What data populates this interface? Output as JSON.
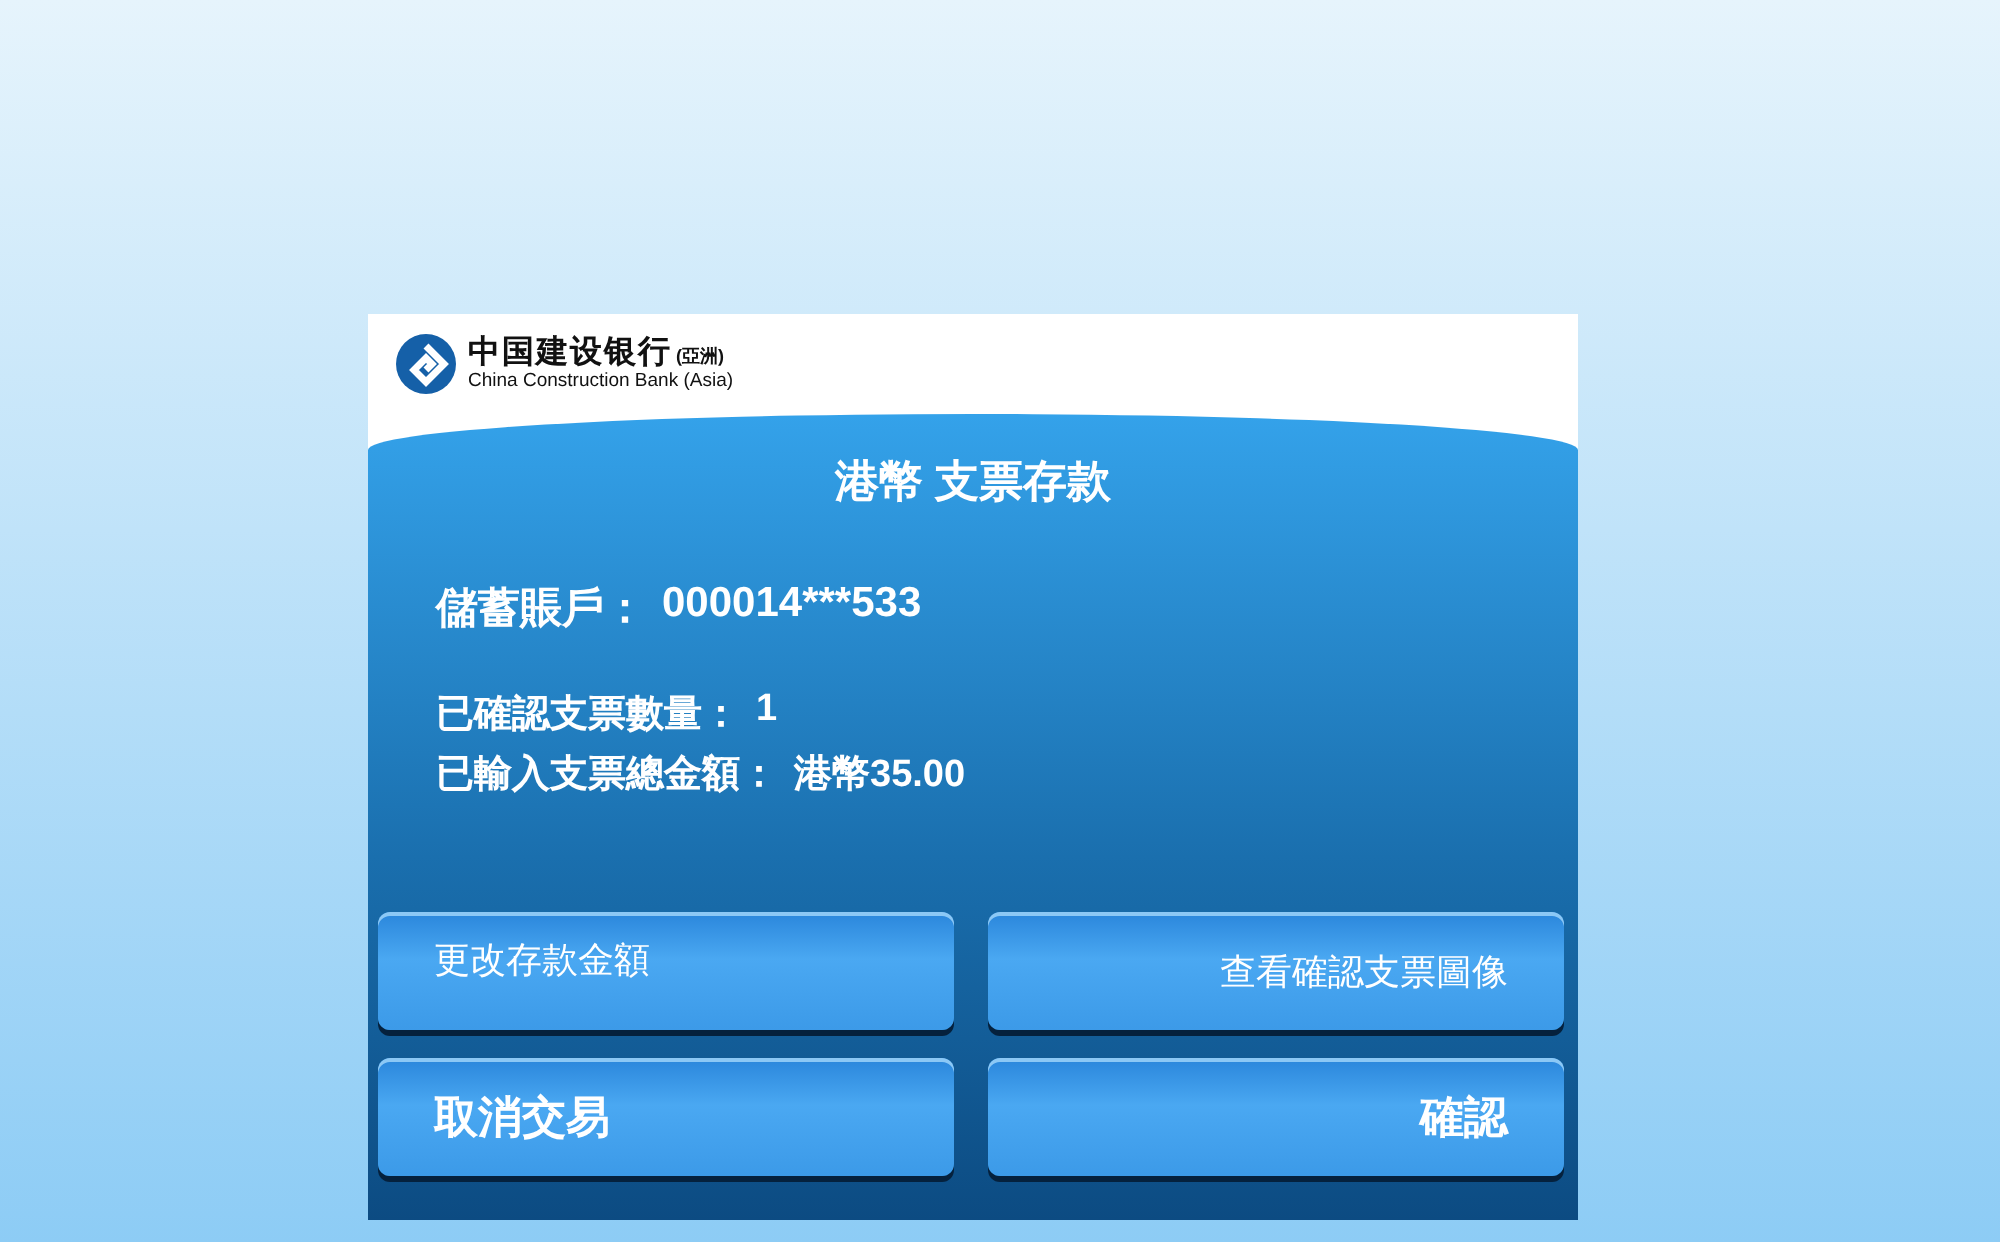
{
  "logo": {
    "name_zh": "中国建设银行",
    "region": "(亞洲)",
    "name_en": "China Construction Bank (Asia)"
  },
  "title": "港幣 支票存款",
  "account": {
    "label": "儲蓄賬戶：",
    "value": "000014***533"
  },
  "summary": [
    {
      "label": "已確認支票數量：",
      "value": "1"
    },
    {
      "label": "已輸入支票總金額：",
      "value": "港幣35.00"
    }
  ],
  "buttons": [
    {
      "label": "更改存款金額",
      "kind": "left"
    },
    {
      "label": "查看確認支票圖像",
      "kind": "right"
    },
    {
      "label": "取消交易",
      "kind": "left"
    },
    {
      "label": "確認",
      "kind": "right"
    }
  ]
}
